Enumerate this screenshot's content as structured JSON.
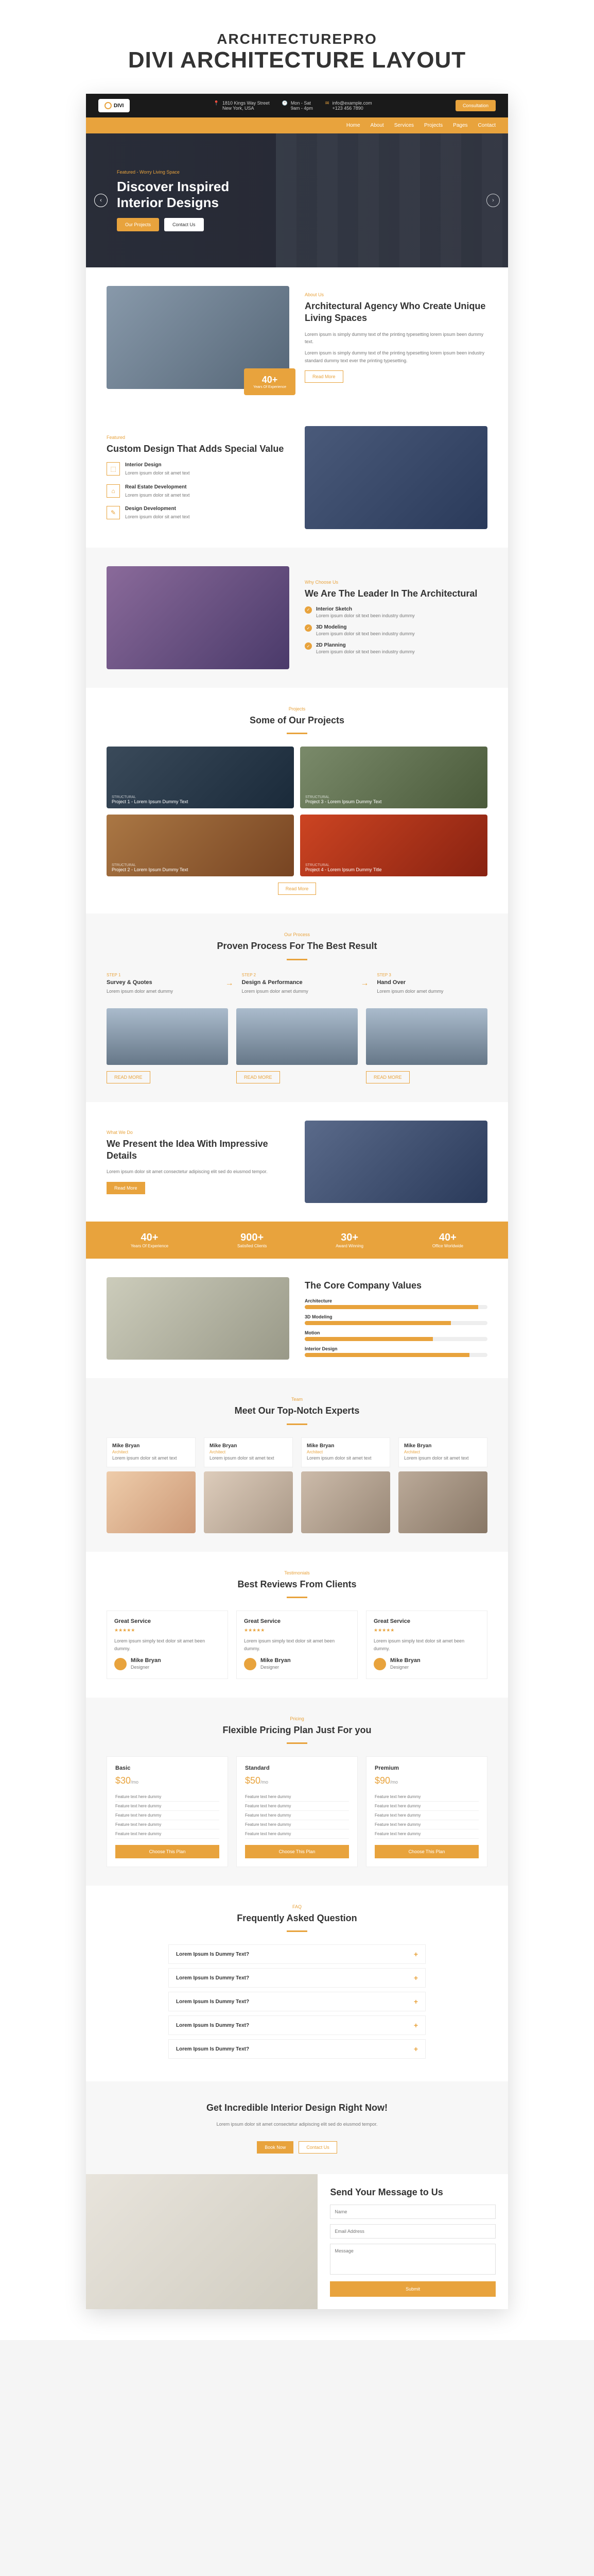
{
  "page_header": {
    "subtitle": "ARCHITECTUREPRO",
    "title": "DIVI ARCHITECTURE LAYOUT"
  },
  "topbar": {
    "logo_text": "DIVI",
    "address_line1": "1810 Kings Way Street",
    "address_line2": "New York, USA",
    "hours_line1": "Mon - Sat",
    "hours_line2": "9am - 4pm",
    "email": "info@example.com",
    "phone": "+123 456 7890",
    "cta": "Consultation"
  },
  "nav": [
    "Home",
    "About",
    "Services",
    "Projects",
    "Pages",
    "Contact"
  ],
  "hero": {
    "tag": "Featured - Worry Living Space",
    "title": "Discover Inspired Interior Designs",
    "primary_btn": "Our Projects",
    "secondary_btn": "Contact Us"
  },
  "about": {
    "tag": "About Us",
    "title": "Architectural Agency Who Create Unique Living Spaces",
    "text1": "Lorem ipsum is simply dummy text of the printing typesetting lorem ipsum been dummy text.",
    "text2": "Lorem ipsum is simply dummy text of the printing typesetting lorem ipsum been industry standard dummy text ever the printing typesetting.",
    "badge_num": "40+",
    "badge_label": "Years Of Experience",
    "btn": "Read More"
  },
  "featured": {
    "tag": "Featured",
    "title": "Custom Design That Adds Special Value",
    "items": [
      {
        "title": "Interior Design",
        "text": "Lorem ipsum dolor sit amet text"
      },
      {
        "title": "Real Estate Development",
        "text": "Lorem ipsum dolor sit amet text"
      },
      {
        "title": "Design Development",
        "text": "Lorem ipsum dolor sit amet text"
      }
    ]
  },
  "leader": {
    "tag": "Why Choose Us",
    "title": "We Are The Leader In The Architectural",
    "items": [
      {
        "title": "Interior Sketch",
        "text": "Lorem ipsum dolor sit text been industry dummy"
      },
      {
        "title": "3D Modeling",
        "text": "Lorem ipsum dolor sit text been industry dummy"
      },
      {
        "title": "2D Planning",
        "text": "Lorem ipsum dolor sit text been industry dummy"
      }
    ]
  },
  "projects": {
    "tag": "Projects",
    "title": "Some of Our Projects",
    "items": [
      {
        "cat": "STRUCTURAL",
        "name": "Project 1 - Lorem Ipsum Dummy Text"
      },
      {
        "cat": "STRUCTURAL",
        "name": "Project 3 - Lorem Ipsum Dummy Text"
      },
      {
        "cat": "STRUCTURAL",
        "name": "Project 2 - Lorem Ipsum Dummy Text"
      },
      {
        "cat": "STRUCTURAL",
        "name": "Project 4 - Lorem Ipsum Dummy Title"
      }
    ],
    "btn": "Read More"
  },
  "process": {
    "tag": "Our Process",
    "title": "Proven Process For The Best Result",
    "steps": [
      {
        "step": "STEP 1",
        "title": "Survey & Quotes",
        "text": "Lorem ipsum dolor amet dummy"
      },
      {
        "step": "STEP 2",
        "title": "Design & Performance",
        "text": "Lorem ipsum dolor amet dummy"
      },
      {
        "step": "STEP 3",
        "title": "Hand Over",
        "text": "Lorem ipsum dolor amet dummy"
      }
    ],
    "btns": [
      "READ MORE",
      "READ MORE",
      "READ MORE"
    ]
  },
  "idea": {
    "tag": "What We Do",
    "title": "We Present the Idea With Impressive Details",
    "text": "Lorem ipsum dolor sit amet consectetur adipiscing elit sed do eiusmod tempor.",
    "btn": "Read More"
  },
  "stats": [
    {
      "num": "40+",
      "label": "Years Of Experience"
    },
    {
      "num": "900+",
      "label": "Satisfied Clients"
    },
    {
      "num": "30+",
      "label": "Award Winning"
    },
    {
      "num": "40+",
      "label": "Office Worldwide"
    }
  ],
  "values": {
    "title": "The Core Company Values",
    "bars": [
      {
        "label": "Architecture",
        "pct": 95
      },
      {
        "label": "3D Modeling",
        "pct": 80
      },
      {
        "label": "Motion",
        "pct": 70
      },
      {
        "label": "Interior Design",
        "pct": 90
      }
    ]
  },
  "team": {
    "tag": "Team",
    "title": "Meet Our Top-Notch Experts",
    "members": [
      {
        "name": "Mike Bryan",
        "role": "Architect",
        "text": "Lorem ipsum dolor sit amet text"
      },
      {
        "name": "Mike Bryan",
        "role": "Architect",
        "text": "Lorem ipsum dolor sit amet text"
      },
      {
        "name": "Mike Bryan",
        "role": "Architect",
        "text": "Lorem ipsum dolor sit amet text"
      },
      {
        "name": "Mike Bryan",
        "role": "Architect",
        "text": "Lorem ipsum dolor sit amet text"
      }
    ]
  },
  "reviews": {
    "tag": "Testimonials",
    "title": "Best Reviews From Clients",
    "items": [
      {
        "title": "Great Service",
        "text": "Lorem ipsum simply text dolor sit amet been dummy.",
        "name": "Mike Bryan",
        "role": "Designer"
      },
      {
        "title": "Great Service",
        "text": "Lorem ipsum simply text dolor sit amet been dummy.",
        "name": "Mike Bryan",
        "role": "Designer"
      },
      {
        "title": "Great Service",
        "text": "Lorem ipsum simply text dolor sit amet been dummy.",
        "name": "Mike Bryan",
        "role": "Designer"
      }
    ]
  },
  "pricing": {
    "tag": "Pricing",
    "title": "Flexible Pricing Plan Just For you",
    "plans": [
      {
        "name": "Basic",
        "price": "$30",
        "per": "/mo",
        "features": [
          "Feature text here dummy",
          "Feature text here dummy",
          "Feature text here dummy",
          "Feature text here dummy",
          "Feature text here dummy"
        ],
        "btn": "Choose This Plan"
      },
      {
        "name": "Standard",
        "price": "$50",
        "per": "/mo",
        "features": [
          "Feature text here dummy",
          "Feature text here dummy",
          "Feature text here dummy",
          "Feature text here dummy",
          "Feature text here dummy"
        ],
        "btn": "Choose This Plan"
      },
      {
        "name": "Premium",
        "price": "$90",
        "per": "/mo",
        "features": [
          "Feature text here dummy",
          "Feature text here dummy",
          "Feature text here dummy",
          "Feature text here dummy",
          "Feature text here dummy"
        ],
        "btn": "Choose This Plan"
      }
    ]
  },
  "faq": {
    "tag": "FAQ",
    "title": "Frequently Asked Question",
    "items": [
      "Lorem Ipsum Is Dummy Text?",
      "Lorem Ipsum Is Dummy Text?",
      "Lorem Ipsum Is Dummy Text?",
      "Lorem Ipsum Is Dummy Text?",
      "Lorem Ipsum Is Dummy Text?"
    ]
  },
  "cta": {
    "title": "Get Incredible Interior Design Right Now!",
    "text": "Lorem ipsum dolor sit amet consectetur adipiscing elit sed do eiusmod tempor.",
    "primary": "Book Now",
    "secondary": "Contact Us"
  },
  "contact": {
    "title": "Send Your Message to Us",
    "name_ph": "Name",
    "email_ph": "Email Address",
    "msg_ph": "Message",
    "btn": "Submit"
  }
}
